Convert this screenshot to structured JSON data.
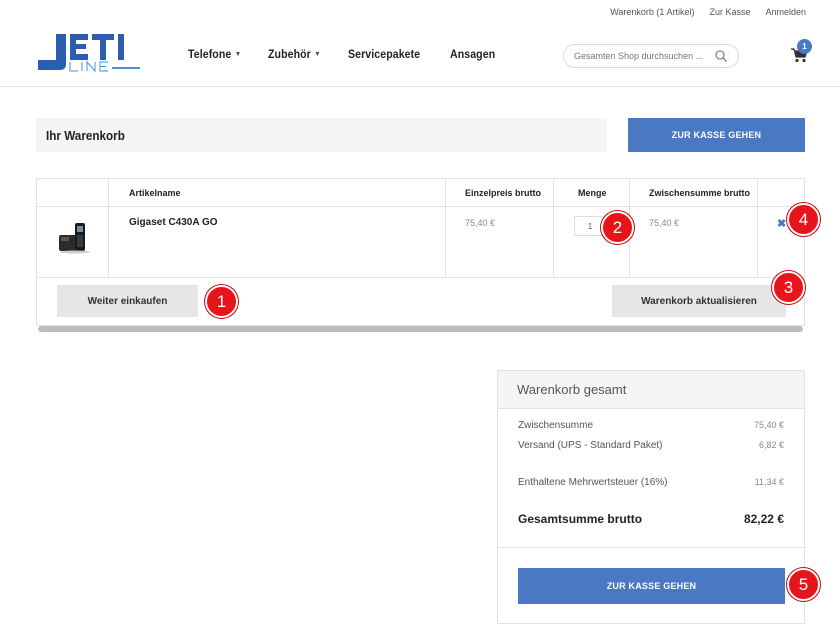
{
  "toplinks": [
    "Warenkorb (1 Artikel)",
    "Zur Kasse",
    "Anmelden"
  ],
  "nav": [
    {
      "label": "Telefone",
      "dropdown": true
    },
    {
      "label": "Zubehör",
      "dropdown": true
    },
    {
      "label": "Servicepakete",
      "dropdown": false
    },
    {
      "label": "Ansagen",
      "dropdown": false
    }
  ],
  "search": {
    "placeholder": "Gesamten Shop durchsuchen ..."
  },
  "cart": {
    "count": "1"
  },
  "colors": {
    "accent": "#4a78c2",
    "marker": "#e8141c",
    "panel": "#f4f5f7"
  },
  "title": "Ihr Warenkorb",
  "checkout_label": "ZUR KASSE GEHEN",
  "table": {
    "headers": [
      "Artikelname",
      "Einzelpreis brutto",
      "Menge",
      "Zwischensumme brutto"
    ],
    "row": {
      "name": "Gigaset C430A GO",
      "price": "75,40 €",
      "qty": "1",
      "subtotal": "75,40 €",
      "remove": "✖"
    }
  },
  "continue_label": "Weiter einkaufen",
  "update_label": "Warenkorb aktualisieren",
  "totals": {
    "heading": "Warenkorb gesamt",
    "rows": [
      {
        "label": "Zwischensumme",
        "value": "75,40 €"
      },
      {
        "label": "Versand (UPS - Standard Paket)",
        "value": "6,82 €"
      },
      {
        "label": "Enthaltene Mehrwertsteuer (16%)",
        "value": "11,34 €"
      }
    ],
    "grand_label": "Gesamtsumme brutto",
    "grand_value": "82,22 €",
    "button_label": "ZUR KASSE GEHEN"
  },
  "markers": [
    "1",
    "2",
    "3",
    "4",
    "5"
  ],
  "logo": {
    "text_top": "JETI",
    "text_bottom": "LINE"
  }
}
